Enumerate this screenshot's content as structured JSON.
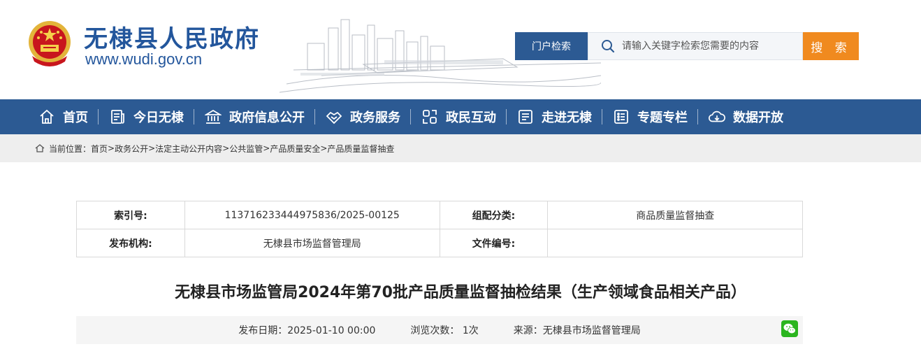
{
  "header": {
    "site_title": "无棣县人民政府",
    "site_url": "www.wudi.gov.cn",
    "search_label": "门户检索",
    "search_placeholder": "请输入关键字检索您需要的内容",
    "search_button": "搜 索"
  },
  "nav": {
    "items": [
      {
        "label": "首页",
        "icon": "home-icon"
      },
      {
        "label": "今日无棣",
        "icon": "news-icon"
      },
      {
        "label": "政府信息公开",
        "icon": "government-building-icon"
      },
      {
        "label": "政务服务",
        "icon": "handshake-icon"
      },
      {
        "label": "政民互动",
        "icon": "interaction-icon"
      },
      {
        "label": "走进无棣",
        "icon": "document-icon"
      },
      {
        "label": "专题专栏",
        "icon": "list-icon"
      },
      {
        "label": "数据开放",
        "icon": "cloud-download-icon"
      }
    ]
  },
  "breadcrumb": {
    "prefix": "当前位置：",
    "items": [
      "首页",
      "政务公开",
      "法定主动公开内容",
      "公共监管",
      "产品质量安全",
      "产品质量监督抽查"
    ]
  },
  "meta": {
    "index_label": "索引号:",
    "index_value": "113716233444975836/2025-00125",
    "category_label": "组配分类:",
    "category_value": "商品质量监督抽查",
    "publisher_label": "发布机构:",
    "publisher_value": "无棣县市场监督管理局",
    "doc_no_label": "文件编号:",
    "doc_no_value": ""
  },
  "article": {
    "title": "无棣县市场监管局2024年第70批产品质量监督抽检结果（生产领域食品相关产品）",
    "publish_date": "发布日期：2025-01-10 00:00",
    "views": "浏览次数： 1次",
    "source": "来源：无棣县市场监督管理局"
  },
  "colors": {
    "primary": "#2c5a93",
    "title_blue": "#23569c",
    "search_button": "#f08a1f",
    "breadcrumb_bg": "#eeeeee",
    "wechat_green": "#2bb51f"
  }
}
